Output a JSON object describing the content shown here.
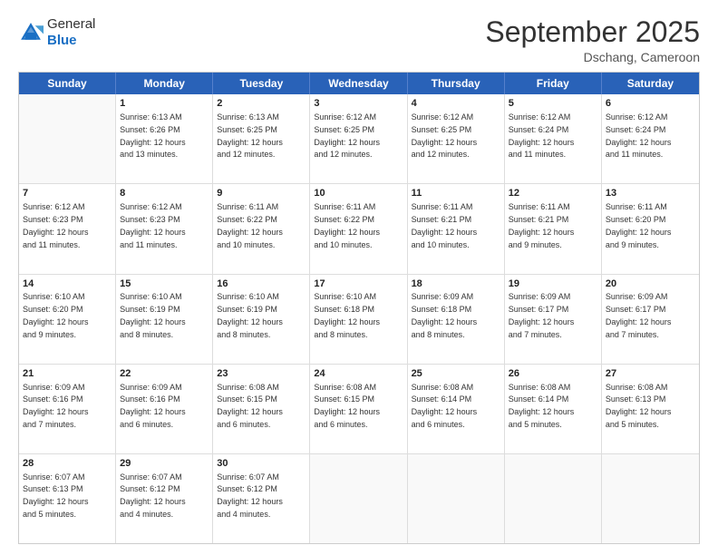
{
  "header": {
    "logo_line1": "General",
    "logo_line2": "Blue",
    "month_title": "September 2025",
    "location": "Dschang, Cameroon"
  },
  "days_of_week": [
    "Sunday",
    "Monday",
    "Tuesday",
    "Wednesday",
    "Thursday",
    "Friday",
    "Saturday"
  ],
  "weeks": [
    [
      {
        "day": "",
        "text": ""
      },
      {
        "day": "1",
        "text": "Sunrise: 6:13 AM\nSunset: 6:26 PM\nDaylight: 12 hours\nand 13 minutes."
      },
      {
        "day": "2",
        "text": "Sunrise: 6:13 AM\nSunset: 6:25 PM\nDaylight: 12 hours\nand 12 minutes."
      },
      {
        "day": "3",
        "text": "Sunrise: 6:12 AM\nSunset: 6:25 PM\nDaylight: 12 hours\nand 12 minutes."
      },
      {
        "day": "4",
        "text": "Sunrise: 6:12 AM\nSunset: 6:25 PM\nDaylight: 12 hours\nand 12 minutes."
      },
      {
        "day": "5",
        "text": "Sunrise: 6:12 AM\nSunset: 6:24 PM\nDaylight: 12 hours\nand 11 minutes."
      },
      {
        "day": "6",
        "text": "Sunrise: 6:12 AM\nSunset: 6:24 PM\nDaylight: 12 hours\nand 11 minutes."
      }
    ],
    [
      {
        "day": "7",
        "text": "Sunrise: 6:12 AM\nSunset: 6:23 PM\nDaylight: 12 hours\nand 11 minutes."
      },
      {
        "day": "8",
        "text": "Sunrise: 6:12 AM\nSunset: 6:23 PM\nDaylight: 12 hours\nand 11 minutes."
      },
      {
        "day": "9",
        "text": "Sunrise: 6:11 AM\nSunset: 6:22 PM\nDaylight: 12 hours\nand 10 minutes."
      },
      {
        "day": "10",
        "text": "Sunrise: 6:11 AM\nSunset: 6:22 PM\nDaylight: 12 hours\nand 10 minutes."
      },
      {
        "day": "11",
        "text": "Sunrise: 6:11 AM\nSunset: 6:21 PM\nDaylight: 12 hours\nand 10 minutes."
      },
      {
        "day": "12",
        "text": "Sunrise: 6:11 AM\nSunset: 6:21 PM\nDaylight: 12 hours\nand 9 minutes."
      },
      {
        "day": "13",
        "text": "Sunrise: 6:11 AM\nSunset: 6:20 PM\nDaylight: 12 hours\nand 9 minutes."
      }
    ],
    [
      {
        "day": "14",
        "text": "Sunrise: 6:10 AM\nSunset: 6:20 PM\nDaylight: 12 hours\nand 9 minutes."
      },
      {
        "day": "15",
        "text": "Sunrise: 6:10 AM\nSunset: 6:19 PM\nDaylight: 12 hours\nand 8 minutes."
      },
      {
        "day": "16",
        "text": "Sunrise: 6:10 AM\nSunset: 6:19 PM\nDaylight: 12 hours\nand 8 minutes."
      },
      {
        "day": "17",
        "text": "Sunrise: 6:10 AM\nSunset: 6:18 PM\nDaylight: 12 hours\nand 8 minutes."
      },
      {
        "day": "18",
        "text": "Sunrise: 6:09 AM\nSunset: 6:18 PM\nDaylight: 12 hours\nand 8 minutes."
      },
      {
        "day": "19",
        "text": "Sunrise: 6:09 AM\nSunset: 6:17 PM\nDaylight: 12 hours\nand 7 minutes."
      },
      {
        "day": "20",
        "text": "Sunrise: 6:09 AM\nSunset: 6:17 PM\nDaylight: 12 hours\nand 7 minutes."
      }
    ],
    [
      {
        "day": "21",
        "text": "Sunrise: 6:09 AM\nSunset: 6:16 PM\nDaylight: 12 hours\nand 7 minutes."
      },
      {
        "day": "22",
        "text": "Sunrise: 6:09 AM\nSunset: 6:16 PM\nDaylight: 12 hours\nand 6 minutes."
      },
      {
        "day": "23",
        "text": "Sunrise: 6:08 AM\nSunset: 6:15 PM\nDaylight: 12 hours\nand 6 minutes."
      },
      {
        "day": "24",
        "text": "Sunrise: 6:08 AM\nSunset: 6:15 PM\nDaylight: 12 hours\nand 6 minutes."
      },
      {
        "day": "25",
        "text": "Sunrise: 6:08 AM\nSunset: 6:14 PM\nDaylight: 12 hours\nand 6 minutes."
      },
      {
        "day": "26",
        "text": "Sunrise: 6:08 AM\nSunset: 6:14 PM\nDaylight: 12 hours\nand 5 minutes."
      },
      {
        "day": "27",
        "text": "Sunrise: 6:08 AM\nSunset: 6:13 PM\nDaylight: 12 hours\nand 5 minutes."
      }
    ],
    [
      {
        "day": "28",
        "text": "Sunrise: 6:07 AM\nSunset: 6:13 PM\nDaylight: 12 hours\nand 5 minutes."
      },
      {
        "day": "29",
        "text": "Sunrise: 6:07 AM\nSunset: 6:12 PM\nDaylight: 12 hours\nand 4 minutes."
      },
      {
        "day": "30",
        "text": "Sunrise: 6:07 AM\nSunset: 6:12 PM\nDaylight: 12 hours\nand 4 minutes."
      },
      {
        "day": "",
        "text": ""
      },
      {
        "day": "",
        "text": ""
      },
      {
        "day": "",
        "text": ""
      },
      {
        "day": "",
        "text": ""
      }
    ]
  ]
}
